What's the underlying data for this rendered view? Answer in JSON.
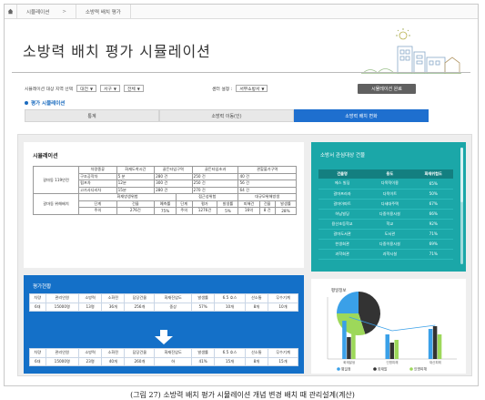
{
  "breadcrumb": {
    "home_icon": "home-icon",
    "items": [
      "시뮬레이션",
      "소방력 배치 평가"
    ]
  },
  "title": "소방력 배치 평가 시뮬레이션",
  "filters": {
    "target_label": "시뮬레이션 대상 지역 선택",
    "sido": "대전",
    "sigungu": "서구",
    "scope": "전체",
    "center_label": "센터 설정 :",
    "center": "서부소방서",
    "save_button": "시뮬레이션 완료"
  },
  "sim_section_label": "평가 시뮬레이션",
  "tabs": [
    {
      "label": "통계",
      "active": false
    },
    {
      "label": "소방력 이동(인)",
      "active": false
    },
    {
      "label": "소방력 배치 변화",
      "active": true
    }
  ],
  "simulation": {
    "title": "시뮬레이션",
    "center_name": "갈마동 119안전",
    "headers_top": [
      "차량종류",
      "화재도착시간",
      "골든타임구역",
      "골든타임초과",
      "관할불가구역"
    ],
    "rows_top": [
      [
        "구조공작차",
        "5 분",
        "280 건",
        "250 건",
        "40 건"
      ],
      [
        "펌프차",
        "12분",
        "300 건",
        "250 건",
        "56 건"
      ],
      [
        "고가사다리차",
        "15분",
        "280 건",
        "270 건",
        "64 건"
      ]
    ],
    "fire_center": "갈마동 위해배치",
    "group_headers": [
      "화재방생위험",
      "접근성위험",
      "대규모위해방생"
    ],
    "sub_headers": [
      "단계",
      "건물",
      "예측률",
      "단계",
      "평가",
      "발생률",
      "피해건",
      "건물",
      "발생률"
    ],
    "sub_values": [
      "주의",
      "276건",
      "75%",
      "주의",
      "1276건",
      "5%",
      "16억",
      "8 건",
      "28%"
    ]
  },
  "interest": {
    "title": "소방서 관심대상 건물",
    "headers": [
      "건물명",
      "용도",
      "화재위험도"
    ],
    "rows": [
      [
        "에스 빌딩",
        "다목적이용",
        "65%"
      ],
      [
        "갈마프라자",
        "다목이트",
        "50%"
      ],
      [
        "갈마아파트",
        "다세대주택",
        "67%"
      ],
      [
        "하남빌딩",
        "다중이용시설",
        "66%"
      ],
      [
        "용산초등학교",
        "학교",
        "92%"
      ],
      [
        "갈마도서관",
        "도서관",
        "71%"
      ],
      [
        "한생회관",
        "다중이용시설",
        "69%"
      ],
      [
        "과학회관",
        "과학시설",
        "71%"
      ]
    ]
  },
  "evaluation": {
    "title": "평가현황",
    "headers": [
      "차량",
      "관리인원",
      "소방력",
      "소화전",
      "담당건물",
      "화재진압도",
      "발생률",
      "6.5 호스",
      "산소통",
      "무수기계"
    ],
    "before": [
      "6대",
      "15000명",
      "13명",
      "36개",
      "256개",
      "중상",
      "57%",
      "10개",
      "8개",
      "10개"
    ],
    "after": [
      "6대",
      "15000명",
      "23명",
      "40개",
      "260개",
      "하",
      "41%",
      "15개",
      "8개",
      "15개"
    ]
  },
  "chart_data": {
    "type": "bar",
    "title": "평일정보",
    "categories": [
      "화재발생",
      "인명피해",
      "재산피해"
    ],
    "series": [
      {
        "name": "평일정",
        "color": "#3aa0e8",
        "values": [
          70,
          45,
          55
        ]
      },
      {
        "name": "화재발",
        "color": "#333333",
        "values": [
          40,
          30,
          60
        ]
      },
      {
        "name": "인명피해",
        "color": "#9dd85a",
        "values": [
          50,
          35,
          45
        ]
      }
    ],
    "pie_labels": [],
    "legend": [
      "평일정",
      "화재발",
      "인명피해"
    ]
  },
  "caption": "(그림 27) 소방력 배치 평가 시뮬레이션 개념 변경 배치 때 관리설계(계산)"
}
